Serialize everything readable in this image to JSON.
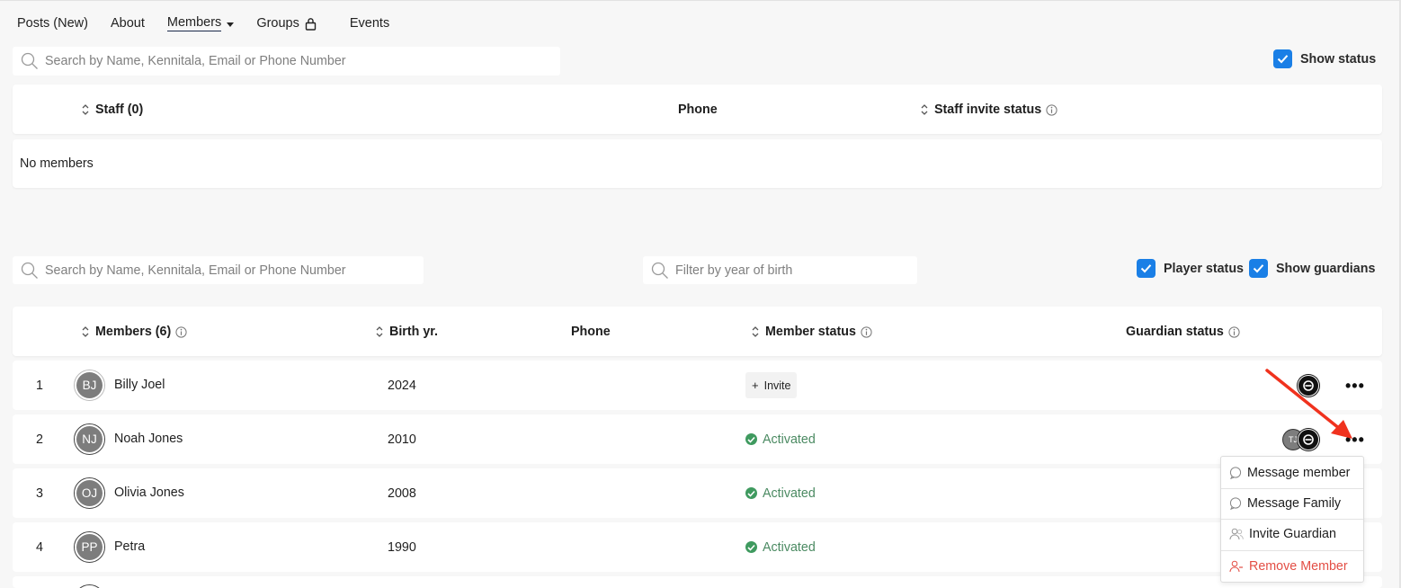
{
  "nav": {
    "posts": "Posts (New)",
    "about": "About",
    "members": "Members",
    "groups": "Groups",
    "events": "Events"
  },
  "staff_search": {
    "placeholder": "Search by Name, Kennitala, Email or Phone Number"
  },
  "show_status": {
    "label": "Show status",
    "checked": true
  },
  "staff_table": {
    "col_staff": "Staff",
    "count": "(0)",
    "col_phone": "Phone",
    "col_invite_status": "Staff invite status",
    "empty": "No members"
  },
  "member_search": {
    "placeholder": "Search by Name, Kennitala, Email or Phone Number"
  },
  "year_filter": {
    "placeholder": "Filter by year of birth"
  },
  "player_status": {
    "label": "Player status",
    "checked": true
  },
  "show_guardians": {
    "label": "Show guardians",
    "checked": true
  },
  "members_table": {
    "col_members": "Members",
    "count": "(6)",
    "col_birth": "Birth yr.",
    "col_phone": "Phone",
    "col_member_status": "Member status",
    "col_guardian_status": "Guardian status",
    "rows": [
      {
        "num": "1",
        "initials": "BJ",
        "name": "Billy Joel",
        "birth": "2024",
        "status": "Invite"
      },
      {
        "num": "2",
        "initials": "NJ",
        "name": "Noah Jones",
        "birth": "2010",
        "status": "Activated",
        "guardian_initials": "TJ"
      },
      {
        "num": "3",
        "initials": "OJ",
        "name": "Olivia Jones",
        "birth": "2008",
        "status": "Activated"
      },
      {
        "num": "4",
        "initials": "PP",
        "name": "Petra",
        "birth": "1990",
        "status": "Activated"
      }
    ]
  },
  "row_menu": {
    "message_member": "Message member",
    "message_family": "Message Family",
    "invite_guardian": "Invite Guardian",
    "remove_member": "Remove Member"
  },
  "colors": {
    "accent": "#1a7fe6",
    "activated": "#4b8a62",
    "danger": "#e34e45",
    "arrow": "#f0321e"
  }
}
